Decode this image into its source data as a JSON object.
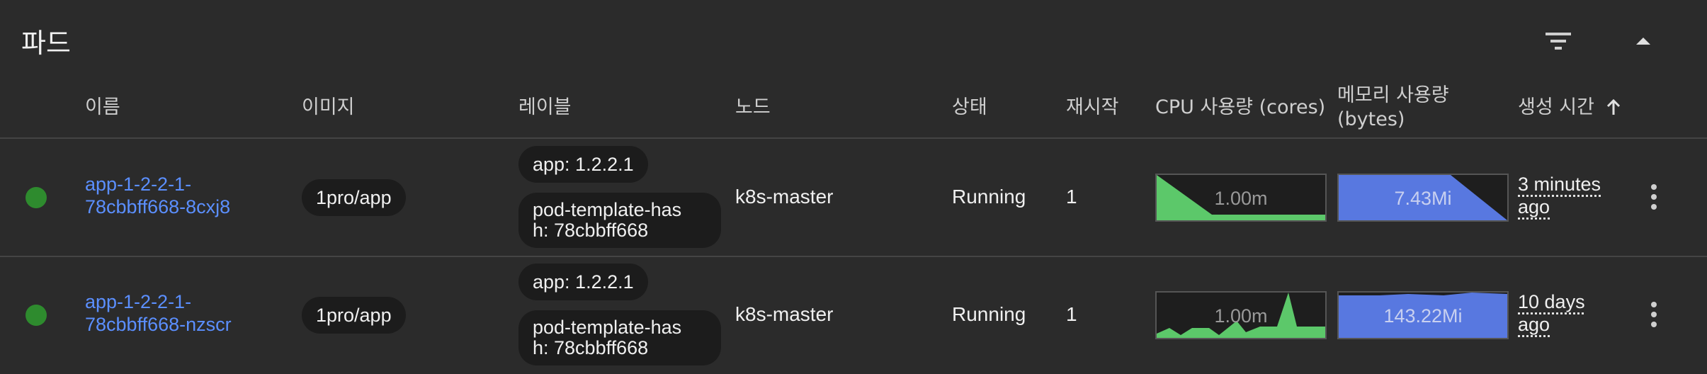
{
  "section": {
    "title": "파드"
  },
  "colors": {
    "running": "#2e8b2e",
    "link": "#5b8fff",
    "cpu_fill": "#5cc86a",
    "mem_fill": "#5878e0"
  },
  "columns": {
    "name": "이름",
    "image": "이미지",
    "labels": "레이블",
    "node": "노드",
    "status": "상태",
    "restarts": "재시작",
    "cpu": "CPU 사용량 (cores)",
    "memory_line1": "메모리 사용량",
    "memory_line2": "(bytes)",
    "created": "생성 시간",
    "sort_icon": "arrow-up-icon"
  },
  "pods": [
    {
      "name_line1": "app-1-2-2-1-",
      "name_line2": "78cbbff668-8cxj8",
      "image": "1pro/app",
      "label_app": "app: 1.2.2.1",
      "label_template_line1": "pod-template-has",
      "label_template_line2": "h: 78cbbff668",
      "node": "k8s-master",
      "status": "Running",
      "restarts": "1",
      "cpu": "1.00m",
      "memory": "7.43Mi",
      "age_line1": "3 minutes",
      "age_line2": "ago"
    },
    {
      "name_line1": "app-1-2-2-1-",
      "name_line2": "78cbbff668-nzscr",
      "image": "1pro/app",
      "label_app": "app: 1.2.2.1",
      "label_template_line1": "pod-template-has",
      "label_template_line2": "h: 78cbbff668",
      "node": "k8s-master",
      "status": "Running",
      "restarts": "1",
      "cpu": "1.00m",
      "memory": "143.22Mi",
      "age_line1": "10 days",
      "age_line2": "ago"
    }
  ]
}
